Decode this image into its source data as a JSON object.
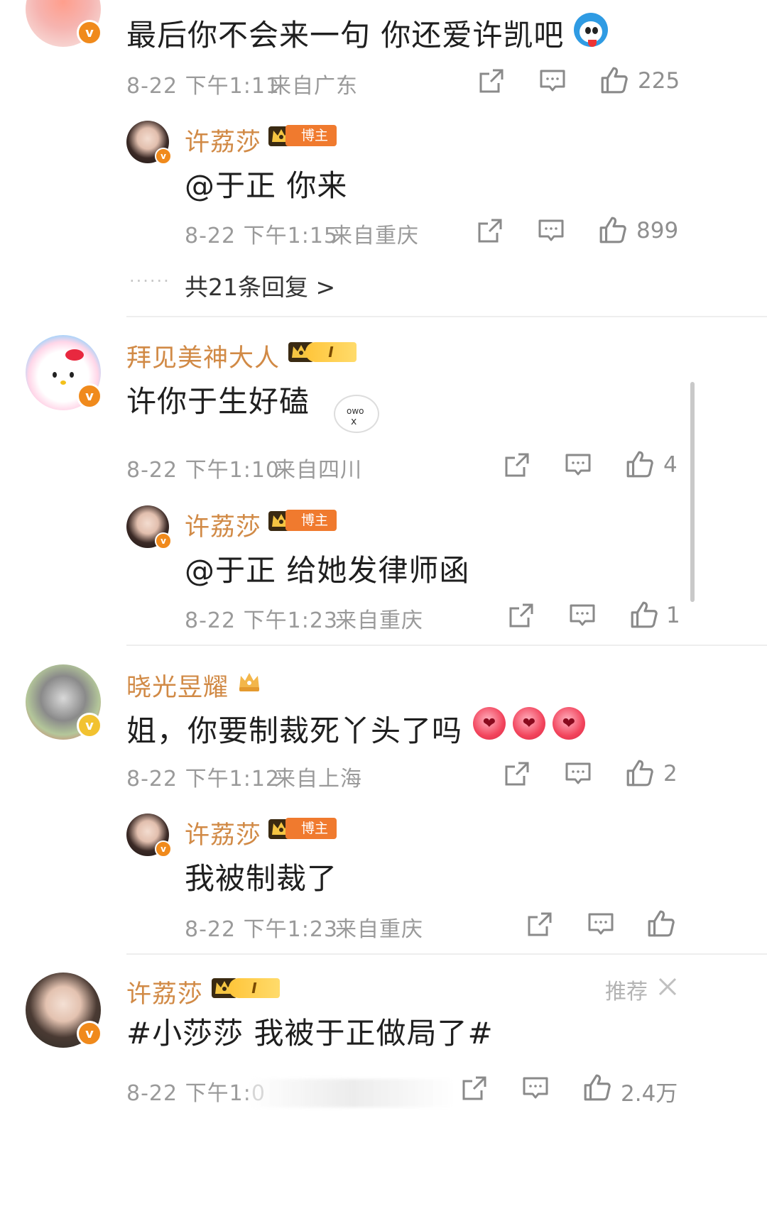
{
  "comments": [
    {
      "text": "最后你不会来一句 你还爱许凯吧",
      "time": "8-22 下午1:11",
      "location": "来自广东",
      "likes": "225",
      "reply": {
        "author": "许荔莎",
        "badge": "博主",
        "text": "@于正 你来",
        "time": "8-22 下午1:15",
        "location": "来自重庆",
        "likes": "899"
      },
      "more_replies": "共21条回复 >"
    },
    {
      "author": "拜见美神大人",
      "level": "I",
      "text": "许你于生好磕",
      "time": "8-22 下午1:10",
      "location": "来自四川",
      "likes": "4",
      "reply": {
        "author": "许荔莎",
        "badge": "博主",
        "text": "@于正 给她发律师函",
        "time": "8-22 下午1:23",
        "location": "来自重庆",
        "likes": "1"
      }
    },
    {
      "author": "晓光昱耀",
      "text": "姐，你要制裁死丫头了吗",
      "time": "8-22 下午1:12",
      "location": "来自上海",
      "likes": "2",
      "reply": {
        "author": "许荔莎",
        "badge": "博主",
        "text": "我被制裁了",
        "time": "8-22 下午1:23",
        "location": "来自重庆"
      }
    },
    {
      "author": "许荔莎",
      "level": "I",
      "text": "#小莎莎 我被于正做局了#",
      "time": "8-22 下午1:0",
      "likes": "2.4万",
      "recommend": "推荐"
    }
  ],
  "icons": {
    "share": "share-icon",
    "comment": "comment-icon",
    "like": "thumbs-up-icon",
    "verified": "verified-v-icon",
    "crown": "crown-icon",
    "close": "close-icon"
  },
  "colors": {
    "username": "#d18a46",
    "meta": "#9a9a9a",
    "host_badge": "#f07a2e",
    "verified": "#f08a1c"
  }
}
